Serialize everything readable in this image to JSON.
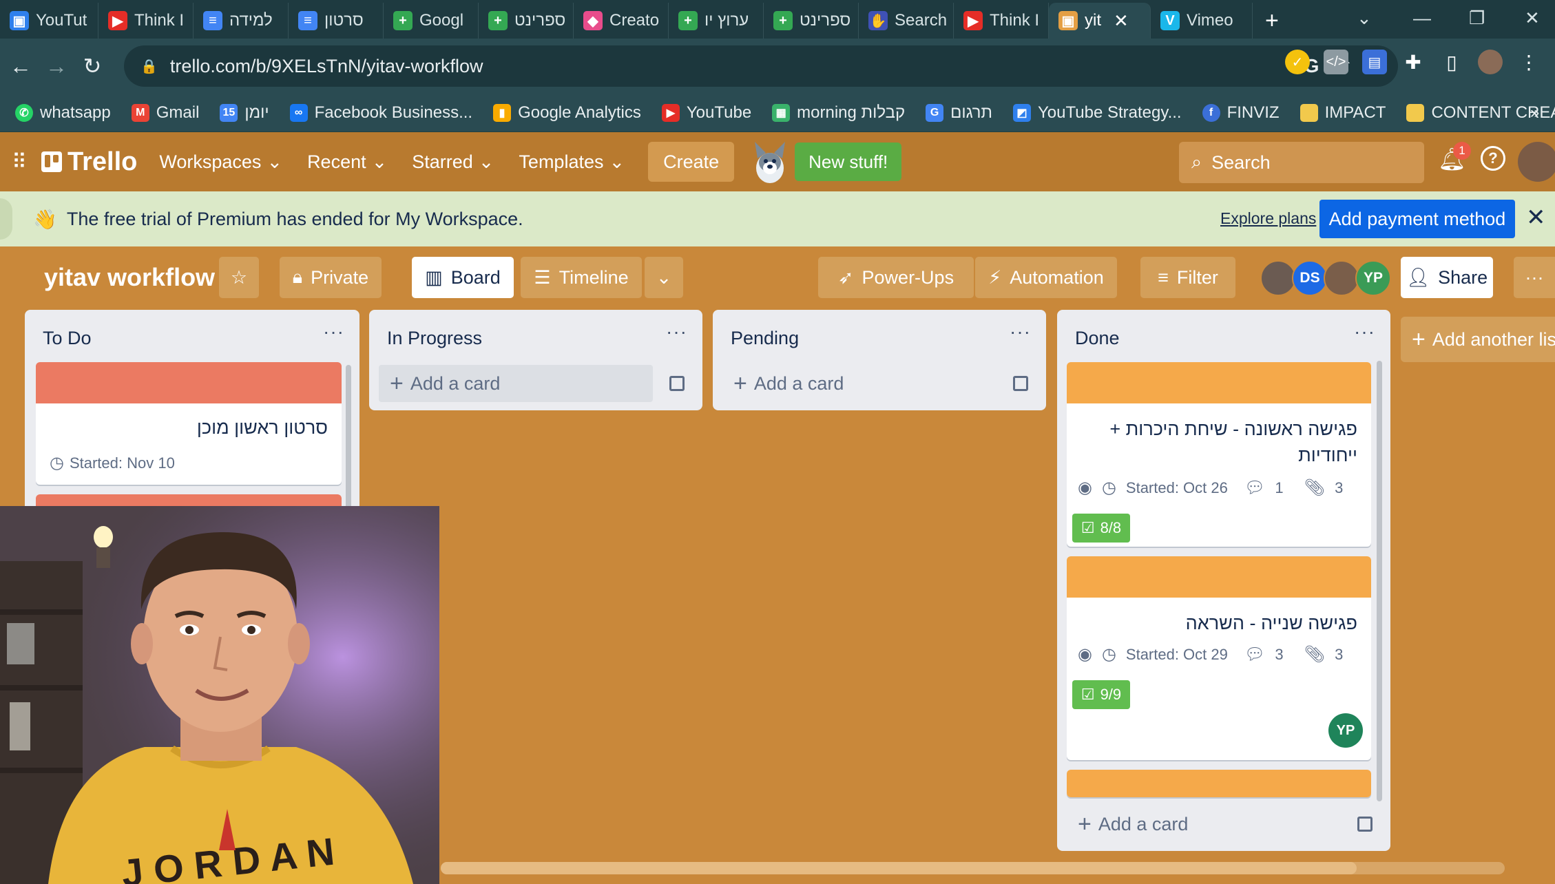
{
  "browser": {
    "tabs": [
      {
        "label": "YouTut",
        "icon": "trello-icon",
        "color": "#2f80ed"
      },
      {
        "label": "Think I",
        "icon": "youtube-icon",
        "color": "#e52d27"
      },
      {
        "label": "למידה",
        "icon": "docs-icon",
        "color": "#4285f4"
      },
      {
        "label": "סרטון",
        "icon": "docs-icon",
        "color": "#4285f4"
      },
      {
        "label": "Googl",
        "icon": "sheets-icon",
        "color": "#34a853"
      },
      {
        "label": "ספרינט",
        "icon": "sheets-icon",
        "color": "#34a853"
      },
      {
        "label": "Creato",
        "icon": "creator-icon",
        "color": "#e84c8b"
      },
      {
        "label": "ערוץ יו",
        "icon": "sheets-icon",
        "color": "#34a853"
      },
      {
        "label": "ספרינט",
        "icon": "sheets-icon",
        "color": "#34a853"
      },
      {
        "label": "Search",
        "icon": "search-tab-icon",
        "color": "#3f51b5"
      },
      {
        "label": "Think I",
        "icon": "youtube-icon",
        "color": "#e52d27"
      },
      {
        "label": "yit",
        "icon": "trello-tab-icon",
        "color": "#e49f44",
        "active": true
      },
      {
        "label": "Vimeo",
        "icon": "vimeo-icon",
        "color": "#1ab7ea"
      }
    ],
    "url": "trello.com/b/9XELsTnN/yitav-workflow",
    "bookmarks": [
      {
        "label": "whatsapp",
        "icon": "whatsapp-icon",
        "color": "#25d366"
      },
      {
        "label": "Gmail",
        "icon": "gmail-icon",
        "color": "#ea4335"
      },
      {
        "label": "יומן",
        "icon": "calendar-icon",
        "color": "#4285f4"
      },
      {
        "label": "Facebook Business...",
        "icon": "meta-icon",
        "color": "#1877f2"
      },
      {
        "label": "Google Analytics",
        "icon": "analytics-icon",
        "color": "#f9ab00"
      },
      {
        "label": "YouTube",
        "icon": "youtube-icon",
        "color": "#e52d27"
      },
      {
        "label": "morning קבלות",
        "icon": "morning-icon",
        "color": "#3ab26b"
      },
      {
        "label": "תרגום",
        "icon": "translate-icon",
        "color": "#4285f4"
      },
      {
        "label": "YouTube Strategy...",
        "icon": "strategy-icon",
        "color": "#2f80ed"
      },
      {
        "label": "FINVIZ",
        "icon": "finviz-icon",
        "color": "#3b6fd8"
      },
      {
        "label": "IMPACT",
        "icon": "folder-icon",
        "color": "#f2c94c"
      },
      {
        "label": "CONTENT CREATOR",
        "icon": "folder-icon",
        "color": "#f2c94c"
      }
    ]
  },
  "header": {
    "logo": "Trello",
    "menus": [
      "Workspaces",
      "Recent",
      "Starred",
      "Templates"
    ],
    "create": "Create",
    "new_stuff": "New stuff!",
    "search_placeholder": "Search",
    "notification_count": "1"
  },
  "banner": {
    "text": "The free trial of Premium has ended for My Workspace.",
    "explore": "Explore plans",
    "pay": "Add payment method"
  },
  "board": {
    "title": "yitav workflow",
    "visibility": "Private",
    "view_board": "Board",
    "view_timeline": "Timeline",
    "powerups": "Power-Ups",
    "automation": "Automation",
    "filter": "Filter",
    "share": "Share",
    "members": [
      {
        "initials": "",
        "color": "#6b5b52"
      },
      {
        "initials": "DS",
        "color": "#1d6ae5"
      },
      {
        "initials": "",
        "color": "#7a5e4a"
      },
      {
        "initials": "YP",
        "color": "#3a9b56"
      }
    ],
    "add_list": "Add another lis",
    "colors": {
      "board_bg": "#c9883a",
      "red_cover": "#eb7a62",
      "orange_cover": "#f5a94a",
      "green_badge": "#61bd4f"
    }
  },
  "lists": {
    "todo": {
      "title": "To Do",
      "cards": [
        {
          "title": "סרטון ראשון מוכן",
          "started": "Started: Nov 10"
        }
      ]
    },
    "progress": {
      "title": "In Progress",
      "add": "Add a card"
    },
    "pending": {
      "title": "Pending",
      "add": "Add a card"
    },
    "done": {
      "title": "Done",
      "add": "Add a card",
      "cards": [
        {
          "title_line1": "פגישה ראשונה - שיחת היכרות +",
          "title_line2": "ייחודיות",
          "started": "Started: Oct 26",
          "comments": "1",
          "attachments": "3",
          "checklist": "8/8"
        },
        {
          "title_line1": "פגישה שנייה - השראה",
          "started": "Started: Oct 29",
          "comments": "3",
          "attachments": "3",
          "checklist": "9/9",
          "member": "YP"
        }
      ]
    }
  }
}
